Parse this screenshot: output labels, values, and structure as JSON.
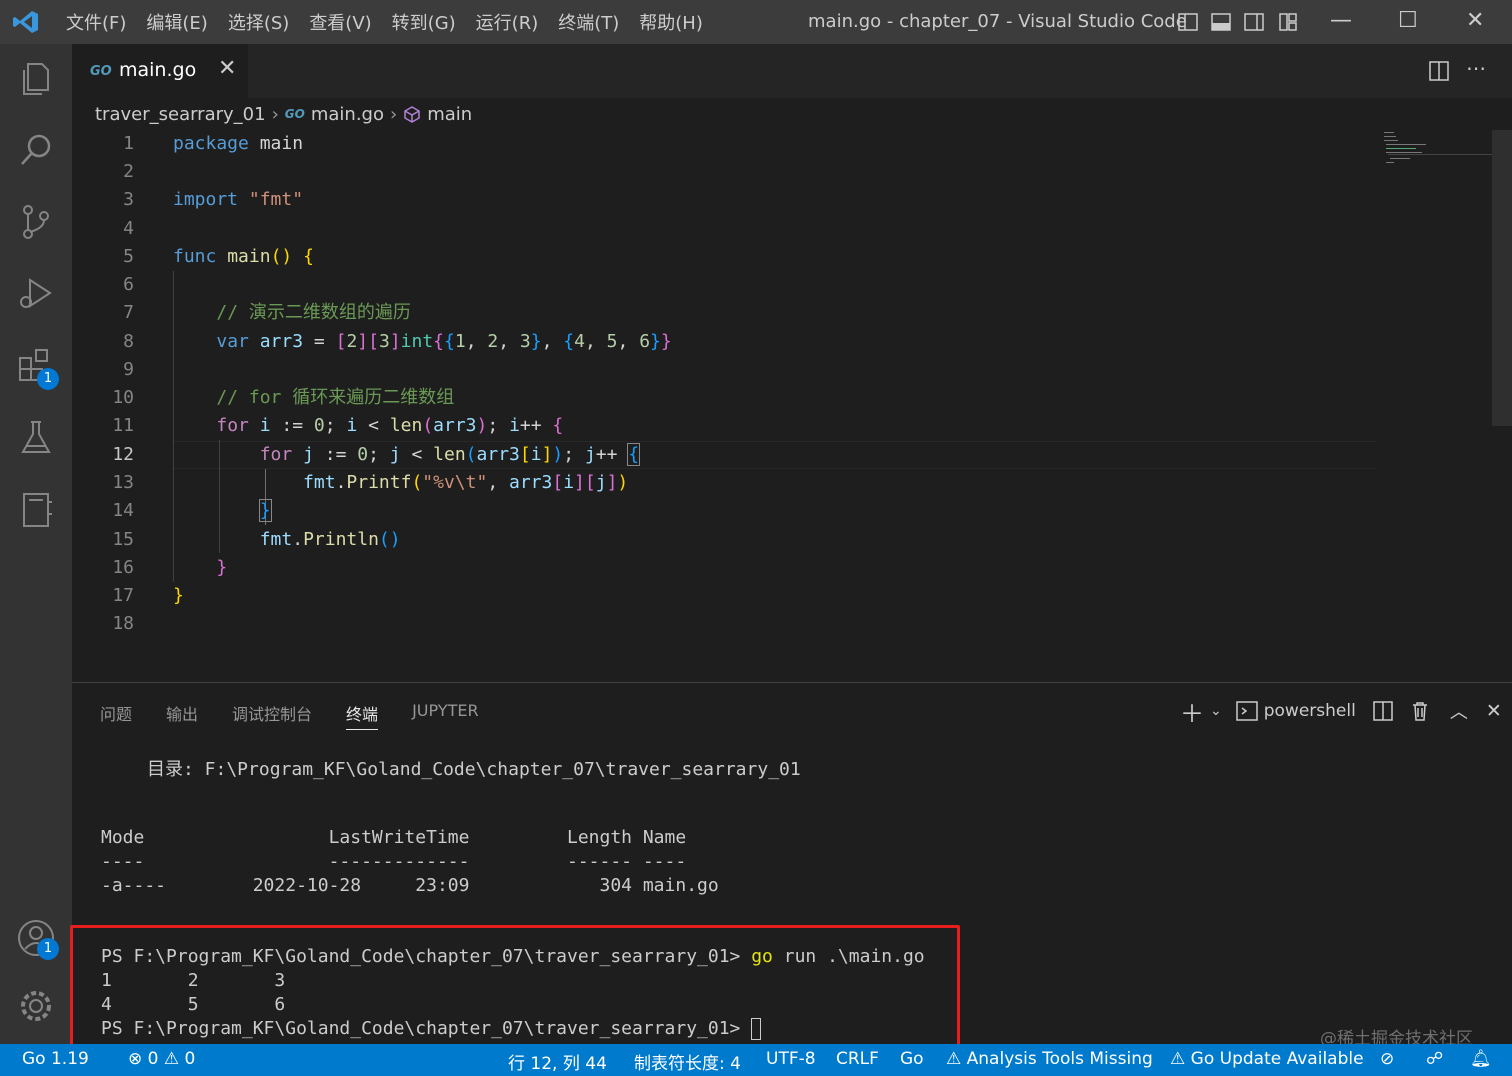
{
  "titlebar": {
    "menu": [
      "文件(F)",
      "编辑(E)",
      "选择(S)",
      "查看(V)",
      "转到(G)",
      "运行(R)",
      "终端(T)",
      "帮助(H)"
    ],
    "window_title": "main.go - chapter_07 - Visual Studio Code"
  },
  "activity_bar": {
    "items": [
      "explorer-icon",
      "search-icon",
      "source-control-icon",
      "run-debug-icon",
      "extensions-icon",
      "testing-icon",
      "notebook-icon"
    ],
    "extensions_badge": "1",
    "accounts_badge": "1"
  },
  "tab": {
    "label": "main.go",
    "icon": "GO",
    "close": "✕"
  },
  "breadcrumb": {
    "folder": "traver_searrary_01",
    "file": "main.go",
    "symbol": "main",
    "go_icon": "GO"
  },
  "editor": {
    "active_line": "12",
    "line_numbers": [
      "1",
      "2",
      "3",
      "4",
      "5",
      "6",
      "7",
      "8",
      "9",
      "10",
      "11",
      "12",
      "13",
      "14",
      "15",
      "16",
      "17",
      "18"
    ]
  },
  "panel": {
    "tabs": [
      "问题",
      "输出",
      "调试控制台",
      "终端",
      "JUPYTER"
    ],
    "active_tab": "终端",
    "shell": "powershell"
  },
  "terminal": {
    "dir_line": "目录: F:\\Program_KF\\Goland_Code\\chapter_07\\traver_searrary_01",
    "header": "Mode                 LastWriteTime         Length Name",
    "underline": "----                 -------------         ------ ----",
    "row": "-a----        2022-10-28     23:09            304 main.go",
    "prompt1": "PS F:\\Program_KF\\Goland_Code\\chapter_07\\traver_searrary_01> ",
    "cmd_go": "go",
    "cmd_rest": " run .\\main.go",
    "out1": "1       2       3",
    "out2": "4       5       6",
    "prompt2": "PS F:\\Program_KF\\Goland_Code\\chapter_07\\traver_searrary_01> "
  },
  "statusbar": {
    "go_version": "Go 1.19",
    "errors": "0",
    "warnings": "0",
    "position": "行 12, 列 44",
    "tab_size": "制表符长度: 4",
    "encoding": "UTF-8",
    "eol": "CRLF",
    "language": "Go",
    "analysis": "Analysis Tools Missing",
    "update": "Go Update Available"
  },
  "watermark": "@稀土掘金技术社区",
  "colors": {
    "accent": "#007acc",
    "highlight_box": "#e81e1e",
    "badge": "#0078d4"
  }
}
